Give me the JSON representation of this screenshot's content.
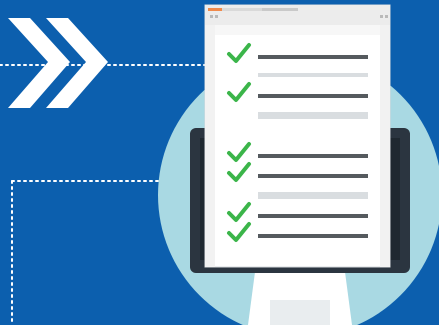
{
  "illustration": {
    "subject": "checklist-on-monitor",
    "colors": {
      "background": "#0c5fae",
      "circle": "#a9d9e3",
      "monitor": "#2b3540",
      "monitor_stand": "#ffffff",
      "document": "#ffffff",
      "window_chrome": "#e6e6e6",
      "window_dot_accent": "#f08a4b",
      "checkmark": "#3bb54a",
      "line_dark": "#555a5e",
      "line_light": "#d9dde0",
      "arrow": "#ffffff",
      "dotted_line": "#ffffff"
    },
    "icons": {
      "arrow_icon": "double-chevron-right-icon",
      "check_icon": "checkmark-icon"
    },
    "checklist_items": [
      {
        "checked": true
      },
      {
        "checked": true
      },
      {
        "checked": false
      },
      {
        "checked": true
      },
      {
        "checked": true
      },
      {
        "checked": false
      },
      {
        "checked": true
      },
      {
        "checked": true
      }
    ]
  }
}
